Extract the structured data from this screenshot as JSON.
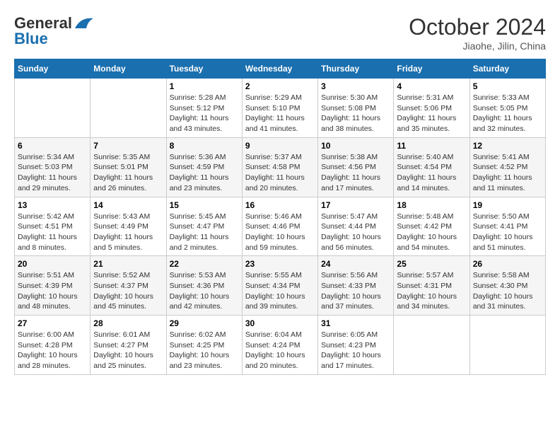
{
  "header": {
    "logo_general": "General",
    "logo_blue": "Blue",
    "month_title": "October 2024",
    "location": "Jiaohe, Jilin, China"
  },
  "weekdays": [
    "Sunday",
    "Monday",
    "Tuesday",
    "Wednesday",
    "Thursday",
    "Friday",
    "Saturday"
  ],
  "weeks": [
    [
      {
        "day": "",
        "info": ""
      },
      {
        "day": "",
        "info": ""
      },
      {
        "day": "1",
        "info": "Sunrise: 5:28 AM\nSunset: 5:12 PM\nDaylight: 11 hours and 43 minutes."
      },
      {
        "day": "2",
        "info": "Sunrise: 5:29 AM\nSunset: 5:10 PM\nDaylight: 11 hours and 41 minutes."
      },
      {
        "day": "3",
        "info": "Sunrise: 5:30 AM\nSunset: 5:08 PM\nDaylight: 11 hours and 38 minutes."
      },
      {
        "day": "4",
        "info": "Sunrise: 5:31 AM\nSunset: 5:06 PM\nDaylight: 11 hours and 35 minutes."
      },
      {
        "day": "5",
        "info": "Sunrise: 5:33 AM\nSunset: 5:05 PM\nDaylight: 11 hours and 32 minutes."
      }
    ],
    [
      {
        "day": "6",
        "info": "Sunrise: 5:34 AM\nSunset: 5:03 PM\nDaylight: 11 hours and 29 minutes."
      },
      {
        "day": "7",
        "info": "Sunrise: 5:35 AM\nSunset: 5:01 PM\nDaylight: 11 hours and 26 minutes."
      },
      {
        "day": "8",
        "info": "Sunrise: 5:36 AM\nSunset: 4:59 PM\nDaylight: 11 hours and 23 minutes."
      },
      {
        "day": "9",
        "info": "Sunrise: 5:37 AM\nSunset: 4:58 PM\nDaylight: 11 hours and 20 minutes."
      },
      {
        "day": "10",
        "info": "Sunrise: 5:38 AM\nSunset: 4:56 PM\nDaylight: 11 hours and 17 minutes."
      },
      {
        "day": "11",
        "info": "Sunrise: 5:40 AM\nSunset: 4:54 PM\nDaylight: 11 hours and 14 minutes."
      },
      {
        "day": "12",
        "info": "Sunrise: 5:41 AM\nSunset: 4:52 PM\nDaylight: 11 hours and 11 minutes."
      }
    ],
    [
      {
        "day": "13",
        "info": "Sunrise: 5:42 AM\nSunset: 4:51 PM\nDaylight: 11 hours and 8 minutes."
      },
      {
        "day": "14",
        "info": "Sunrise: 5:43 AM\nSunset: 4:49 PM\nDaylight: 11 hours and 5 minutes."
      },
      {
        "day": "15",
        "info": "Sunrise: 5:45 AM\nSunset: 4:47 PM\nDaylight: 11 hours and 2 minutes."
      },
      {
        "day": "16",
        "info": "Sunrise: 5:46 AM\nSunset: 4:46 PM\nDaylight: 10 hours and 59 minutes."
      },
      {
        "day": "17",
        "info": "Sunrise: 5:47 AM\nSunset: 4:44 PM\nDaylight: 10 hours and 56 minutes."
      },
      {
        "day": "18",
        "info": "Sunrise: 5:48 AM\nSunset: 4:42 PM\nDaylight: 10 hours and 54 minutes."
      },
      {
        "day": "19",
        "info": "Sunrise: 5:50 AM\nSunset: 4:41 PM\nDaylight: 10 hours and 51 minutes."
      }
    ],
    [
      {
        "day": "20",
        "info": "Sunrise: 5:51 AM\nSunset: 4:39 PM\nDaylight: 10 hours and 48 minutes."
      },
      {
        "day": "21",
        "info": "Sunrise: 5:52 AM\nSunset: 4:37 PM\nDaylight: 10 hours and 45 minutes."
      },
      {
        "day": "22",
        "info": "Sunrise: 5:53 AM\nSunset: 4:36 PM\nDaylight: 10 hours and 42 minutes."
      },
      {
        "day": "23",
        "info": "Sunrise: 5:55 AM\nSunset: 4:34 PM\nDaylight: 10 hours and 39 minutes."
      },
      {
        "day": "24",
        "info": "Sunrise: 5:56 AM\nSunset: 4:33 PM\nDaylight: 10 hours and 37 minutes."
      },
      {
        "day": "25",
        "info": "Sunrise: 5:57 AM\nSunset: 4:31 PM\nDaylight: 10 hours and 34 minutes."
      },
      {
        "day": "26",
        "info": "Sunrise: 5:58 AM\nSunset: 4:30 PM\nDaylight: 10 hours and 31 minutes."
      }
    ],
    [
      {
        "day": "27",
        "info": "Sunrise: 6:00 AM\nSunset: 4:28 PM\nDaylight: 10 hours and 28 minutes."
      },
      {
        "day": "28",
        "info": "Sunrise: 6:01 AM\nSunset: 4:27 PM\nDaylight: 10 hours and 25 minutes."
      },
      {
        "day": "29",
        "info": "Sunrise: 6:02 AM\nSunset: 4:25 PM\nDaylight: 10 hours and 23 minutes."
      },
      {
        "day": "30",
        "info": "Sunrise: 6:04 AM\nSunset: 4:24 PM\nDaylight: 10 hours and 20 minutes."
      },
      {
        "day": "31",
        "info": "Sunrise: 6:05 AM\nSunset: 4:23 PM\nDaylight: 10 hours and 17 minutes."
      },
      {
        "day": "",
        "info": ""
      },
      {
        "day": "",
        "info": ""
      }
    ]
  ]
}
